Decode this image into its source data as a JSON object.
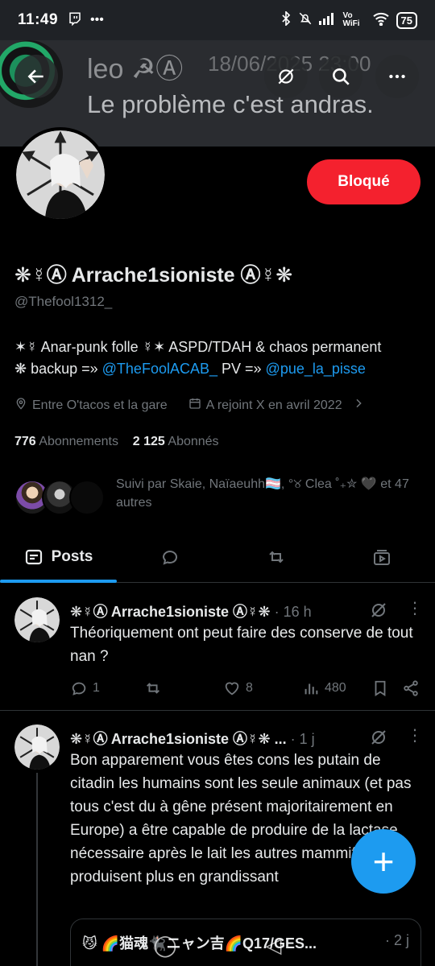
{
  "status_bar": {
    "time": "11:49",
    "left_icons": [
      "twitch-icon",
      "more-dots"
    ],
    "extra": "•••",
    "right_icons": [
      "bluetooth-icon",
      "mute-icon",
      "signal-icon",
      "vowifi-icon",
      "wifi-icon"
    ],
    "vowifi": "Vo WiFi",
    "battery": "75"
  },
  "banner": {
    "ghost_name": "leo ☭Ⓐ",
    "ghost_date": "18/06/2025 23:00",
    "ghost_text": "Le problème c'est andras.",
    "ghost_text2": "",
    "icons": [
      "back-arrow-icon",
      "grok-icon",
      "search-icon",
      "more-icon"
    ]
  },
  "profile": {
    "blocked_label": "Bloqué",
    "display_name": "❋☿Ⓐ Arrache1sioniste Ⓐ☿❋",
    "handle": "@Thefool1312_",
    "bio_line1": "✶☿ Anar-punk folle ☿✶ ASPD/TDAH & chaos permanent",
    "bio_line2_a": "❋ backup =» ",
    "bio_link1": "@TheFoolACAB_",
    "bio_line2_b": " PV =» ",
    "bio_link2": "@pue_la_pisse",
    "location": "Entre O'tacos et la gare",
    "joined": "A rejoint X en avril 2022",
    "following_count": "776",
    "following_label": "Abonnements",
    "followers_count": "2 125",
    "followers_label": "Abonnés",
    "followed_by": "Suivi par Skaie, Naïaeuhh🏳️‍⚧️, °୪ Clea ˚₊✮ 🖤 et 47 autres"
  },
  "tabs": {
    "posts": "Posts",
    "icons": [
      "posts-icon",
      "replies-icon",
      "repost-icon",
      "media-icon"
    ]
  },
  "tweets": [
    {
      "name": "❋☿Ⓐ Arrache1sioniste Ⓐ☿❋",
      "meta": " · 16 h",
      "text": "Théoriquement ont peut faire des conserve de tout nan ?",
      "replies": "1",
      "reposts": "",
      "likes": "8",
      "views": "480"
    },
    {
      "name": "❋☿Ⓐ Arrache1sioniste Ⓐ☿❋ ...",
      "meta": " · 1 j",
      "text": "Bon apparement vous êtes cons les putain de citadin les humains sont les seule animaux (et pas tous c'est du à gêne présent majoritairement en Europe) a être capable de produire de la lactase nécessaire après le lait les autres mammifère n'en produisent plus en grandissant"
    }
  ],
  "quote": {
    "head": "😼 🌈猫魂🐈‍⬛ニャン吉🌈Q17/GES...",
    "meta": "· 2 j"
  },
  "fab_label": "+",
  "colors": {
    "accent": "#1d9bf0",
    "blocked": "#f4212e",
    "muted": "#71767b",
    "text": "#e7e9ea"
  }
}
